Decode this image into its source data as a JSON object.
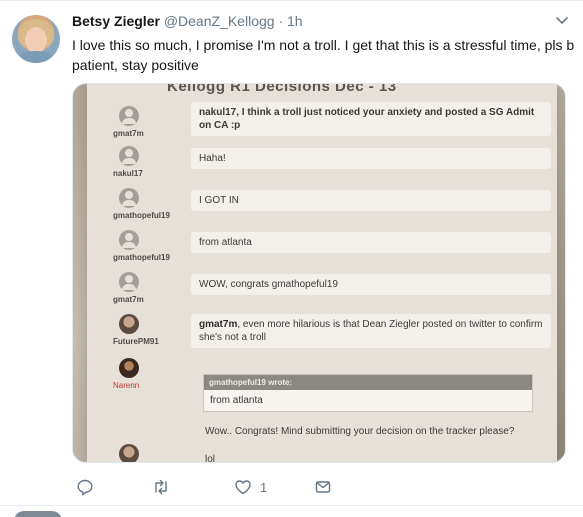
{
  "tweet": {
    "name": "Betsy Ziegler",
    "handle": "@DeanZ_Kellogg",
    "separator": "·",
    "time": "1h",
    "text": "I love this so much, I promise I'm not a troll. I get that this is a stressful time, pls b patient, stay positive"
  },
  "media": {
    "chat_title": "Kellogg R1 Decisions Dec - 13",
    "messages": [
      {
        "user": "gmat7m",
        "text": "nakul17, I think a troll just noticed your anxiety and posted a SG Admit on CA :p",
        "bold_prefix": ""
      },
      {
        "user": "nakul17",
        "text": "Haha!",
        "bold_prefix": ""
      },
      {
        "user": "gmathopeful19",
        "text": "I GOT IN",
        "bold_prefix": ""
      },
      {
        "user": "gmathopeful19",
        "text": "from atlanta",
        "bold_prefix": ""
      },
      {
        "user": "gmat7m",
        "text": "WOW, congrats gmathopeful19",
        "bold_prefix": ""
      },
      {
        "user": "FuturePM91",
        "bold_prefix": "gmat7m",
        "text": ", even more hilarious is that Dean Ziegler posted on twitter to confirm she's not a troll"
      },
      {
        "user": "Narenn",
        "quote_head": "gmathopeful19 wrote:",
        "quote_body": "from atlanta",
        "text": "Wow.. Congrats! Mind submitting your decision on the tracker please?"
      },
      {
        "user": "",
        "text": "lol"
      }
    ]
  },
  "actions": {
    "reply_count": "",
    "retweet_count": "",
    "like_count": "1",
    "icons": [
      "reply-icon",
      "retweet-icon",
      "like-icon",
      "message-icon"
    ]
  },
  "colors": {
    "text": "#14171a",
    "secondary": "#657786",
    "border": "#e6ecf0",
    "username_red": "#c0392b"
  }
}
